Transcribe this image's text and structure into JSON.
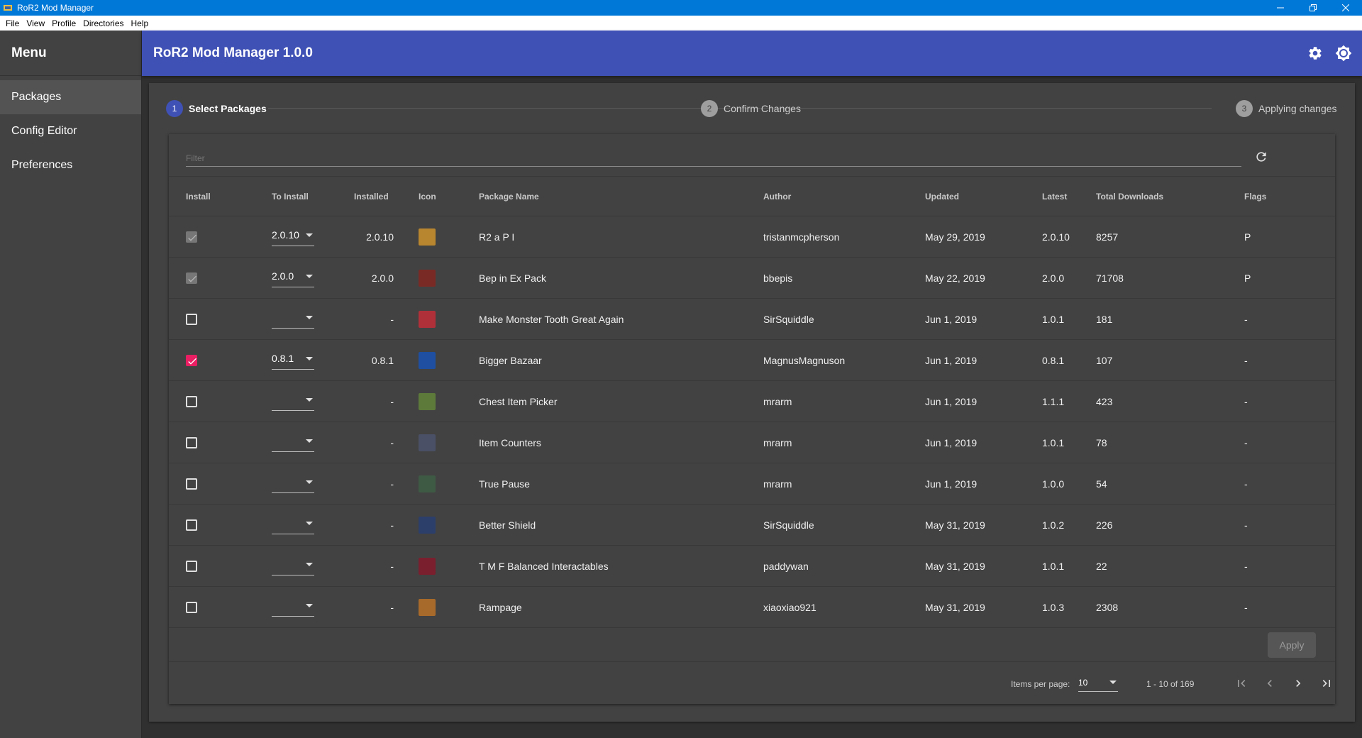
{
  "window": {
    "title": "RoR2 Mod Manager"
  },
  "menubar": [
    "File",
    "View",
    "Profile",
    "Directories",
    "Help"
  ],
  "sidebar": {
    "title": "Menu",
    "items": [
      {
        "label": "Packages",
        "active": true
      },
      {
        "label": "Config Editor",
        "active": false
      },
      {
        "label": "Preferences",
        "active": false
      }
    ]
  },
  "header": {
    "title": "RoR2 Mod Manager 1.0.0"
  },
  "stepper": [
    {
      "num": "1",
      "label": "Select Packages",
      "active": true
    },
    {
      "num": "2",
      "label": "Confirm Changes",
      "active": false
    },
    {
      "num": "3",
      "label": "Applying changes",
      "active": false
    }
  ],
  "filter": {
    "placeholder": "Filter"
  },
  "table": {
    "columns": [
      "Install",
      "To Install",
      "Installed",
      "Icon",
      "Package Name",
      "Author",
      "Updated",
      "Latest",
      "Total Downloads",
      "Flags"
    ],
    "rows": [
      {
        "install": "disabled",
        "to_install": "2.0.10",
        "installed": "2.0.10",
        "icon_color": "#b8862e",
        "name": "R2 a P I",
        "author": "tristanmcpherson",
        "updated": "May 29, 2019",
        "latest": "2.0.10",
        "downloads": "8257",
        "flags": "P"
      },
      {
        "install": "disabled",
        "to_install": "2.0.0",
        "installed": "2.0.0",
        "icon_color": "#7a2a24",
        "name": "Bep in Ex Pack",
        "author": "bbepis",
        "updated": "May 22, 2019",
        "latest": "2.0.0",
        "downloads": "71708",
        "flags": "P"
      },
      {
        "install": "unchecked",
        "to_install": "",
        "installed": "-",
        "icon_color": "#b0303a",
        "name": "Make Monster Tooth Great Again",
        "author": "SirSquiddle",
        "updated": "Jun 1, 2019",
        "latest": "1.0.1",
        "downloads": "181",
        "flags": "-"
      },
      {
        "install": "checked",
        "to_install": "0.8.1",
        "installed": "0.8.1",
        "icon_color": "#1e4fa0",
        "name": "Bigger Bazaar",
        "author": "MagnusMagnuson",
        "updated": "Jun 1, 2019",
        "latest": "0.8.1",
        "downloads": "107",
        "flags": "-"
      },
      {
        "install": "unchecked",
        "to_install": "",
        "installed": "-",
        "icon_color": "#5d7a3a",
        "name": "Chest Item Picker",
        "author": "mrarm",
        "updated": "Jun 1, 2019",
        "latest": "1.1.1",
        "downloads": "423",
        "flags": "-"
      },
      {
        "install": "unchecked",
        "to_install": "",
        "installed": "-",
        "icon_color": "#4a5066",
        "name": "Item Counters",
        "author": "mrarm",
        "updated": "Jun 1, 2019",
        "latest": "1.0.1",
        "downloads": "78",
        "flags": "-"
      },
      {
        "install": "unchecked",
        "to_install": "",
        "installed": "-",
        "icon_color": "#3e5a44",
        "name": "True Pause",
        "author": "mrarm",
        "updated": "Jun 1, 2019",
        "latest": "1.0.0",
        "downloads": "54",
        "flags": "-"
      },
      {
        "install": "unchecked",
        "to_install": "",
        "installed": "-",
        "icon_color": "#2c3e6a",
        "name": "Better Shield",
        "author": "SirSquiddle",
        "updated": "May 31, 2019",
        "latest": "1.0.2",
        "downloads": "226",
        "flags": "-"
      },
      {
        "install": "unchecked",
        "to_install": "",
        "installed": "-",
        "icon_color": "#7a1f2e",
        "name": "T M F Balanced Interactables",
        "author": "paddywan",
        "updated": "May 31, 2019",
        "latest": "1.0.1",
        "downloads": "22",
        "flags": "-"
      },
      {
        "install": "unchecked",
        "to_install": "",
        "installed": "-",
        "icon_color": "#a86a2a",
        "name": "Rampage",
        "author": "xiaoxiao921",
        "updated": "May 31, 2019",
        "latest": "1.0.3",
        "downloads": "2308",
        "flags": "-"
      }
    ]
  },
  "apply": {
    "label": "Apply"
  },
  "paginator": {
    "items_per_page_label": "Items per page:",
    "items_per_page": "10",
    "range": "1 - 10 of 169"
  },
  "colors": {
    "header": "#3f51b5",
    "accent": "#e91e63",
    "titlebar": "#0078d7"
  }
}
